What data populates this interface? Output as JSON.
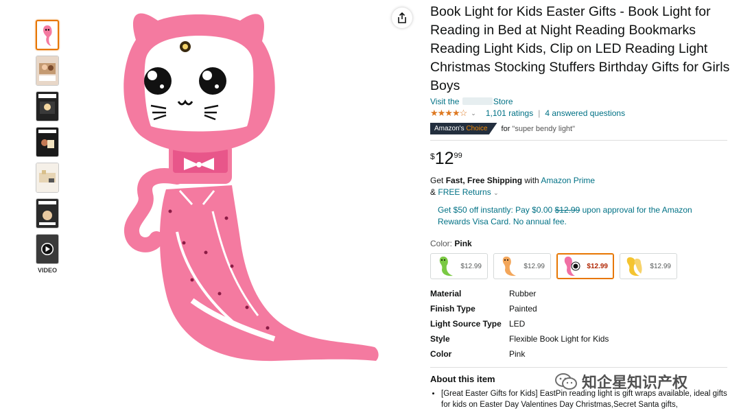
{
  "thumbnails": {
    "video_label": "VIDEO"
  },
  "product": {
    "title": "Book Light for Kids Easter Gifts - Book Light for Reading in Bed at Night Reading Bookmarks Reading Light Kids, Clip on LED Reading Light Christmas Stocking Stuffers Birthday Gifts for Girls Boys",
    "store_prefix": "Visit the",
    "store_suffix": "Store",
    "stars": "★★★★☆",
    "rating_value": 4.5,
    "ratings_count": "1,101 ratings",
    "answered": "4 answered questions",
    "badge_left": "Amazon's",
    "badge_right": "Choice",
    "choice_for": "for",
    "choice_query": "\"super bendy light\""
  },
  "price": {
    "currency": "$",
    "whole": "12",
    "fraction": "99"
  },
  "shipping": {
    "line1_pre": "Get",
    "line1_bold": "Fast, Free Shipping",
    "line1_mid": "with",
    "line1_link": "Amazon Prime",
    "line2_amp": "&",
    "line2_link": "FREE Returns"
  },
  "visa": {
    "pre": "Get $50 off instantly: Pay $0.00",
    "strike": "$12.99",
    "post": "upon approval for the Amazon Rewards Visa Card. No annual fee."
  },
  "color": {
    "label": "Color:",
    "selected": "Pink",
    "options": [
      {
        "price": "$12.99",
        "tint": "#7ac943"
      },
      {
        "price": "$12.99",
        "tint": "#f3a65a"
      },
      {
        "price": "$12.99",
        "tint": "#f06fa4"
      },
      {
        "price": "$12.99",
        "tint": "#f4c430"
      }
    ]
  },
  "specs": [
    {
      "key": "Material",
      "value": "Rubber"
    },
    {
      "key": "Finish Type",
      "value": "Painted"
    },
    {
      "key": "Light Source Type",
      "value": "LED"
    },
    {
      "key": "Style",
      "value": "Flexible Book Light for Kids"
    },
    {
      "key": "Color",
      "value": "Pink"
    }
  ],
  "about": {
    "heading": "About this item",
    "bullet1": "[Great Easter Gifts for Kids] EastPin reading light is gift wraps available, ideal gifts for kids on Easter Day Valentines Day Christmas,Secret Santa gifts,"
  },
  "watermark": "知企星知识产权",
  "colors": {
    "link": "#007185",
    "accent": "#e77600",
    "star": "#de7921",
    "price_red": "#b12704",
    "product_pink": "#f47aa0"
  }
}
